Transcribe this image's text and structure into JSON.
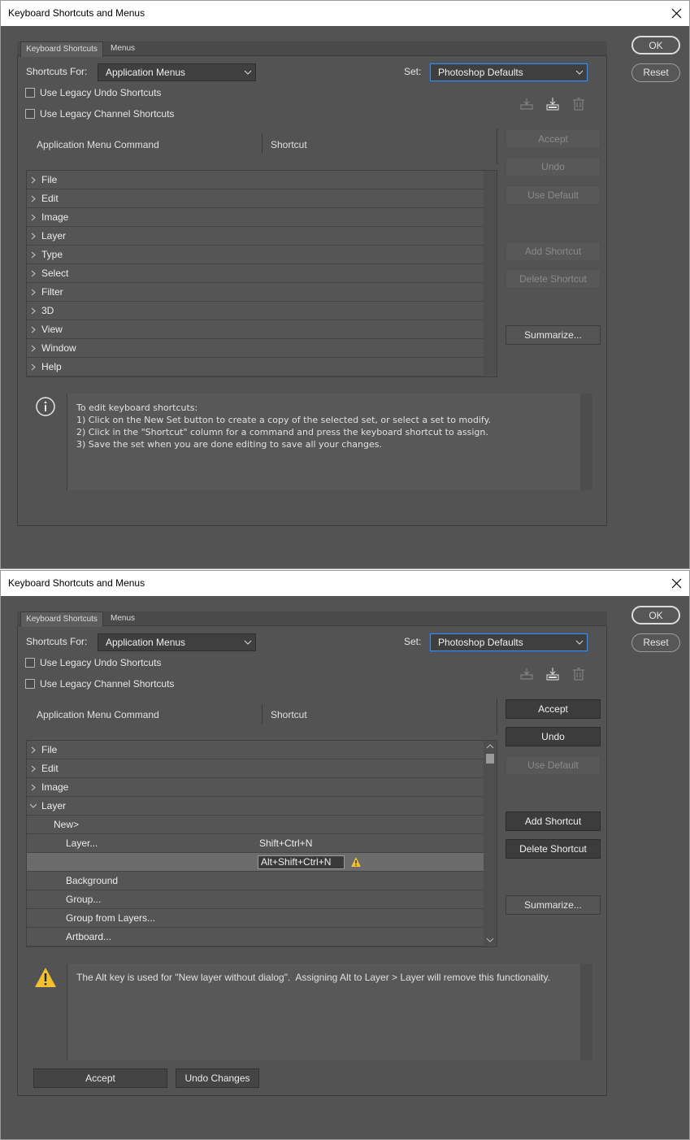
{
  "dialog1": {
    "title": "Keyboard Shortcuts and Menus",
    "tabs": [
      "Keyboard Shortcuts",
      "Menus"
    ],
    "shortcuts_for_label": "Shortcuts For:",
    "shortcuts_for_value": "Application Menus",
    "set_label": "Set:",
    "set_value": "Photoshop Defaults",
    "legacy_undo": "Use Legacy Undo Shortcuts",
    "legacy_channel": "Use Legacy Channel Shortcuts",
    "col_command": "Application Menu Command",
    "col_shortcut": "Shortcut",
    "menus": [
      "File",
      "Edit",
      "Image",
      "Layer",
      "Type",
      "Select",
      "Filter",
      "3D",
      "View",
      "Window",
      "Help"
    ],
    "buttons": {
      "ok": "OK",
      "reset": "Reset",
      "accept": "Accept",
      "undo": "Undo",
      "use_default": "Use Default",
      "add_shortcut": "Add Shortcut",
      "delete_shortcut": "Delete Shortcut",
      "summarize": "Summarize..."
    },
    "info_text": "To edit keyboard shortcuts:\n1) Click on the New Set button to create a copy of the selected set, or select a set to modify.\n2) Click in the \"Shortcut\" column for a command and press the keyboard shortcut to assign.\n3) Save the set when you are done editing to save all your changes."
  },
  "dialog2": {
    "title": "Keyboard Shortcuts and Menus",
    "tabs": [
      "Keyboard Shortcuts",
      "Menus"
    ],
    "shortcuts_for_label": "Shortcuts For:",
    "shortcuts_for_value": "Application Menus",
    "set_label": "Set:",
    "set_value": "Photoshop Defaults",
    "legacy_undo": "Use Legacy Undo Shortcuts",
    "legacy_channel": "Use Legacy Channel Shortcuts",
    "col_command": "Application Menu Command",
    "col_shortcut": "Shortcut",
    "rows": [
      {
        "label": "File",
        "shortcut": ""
      },
      {
        "label": "Edit",
        "shortcut": ""
      },
      {
        "label": "Image",
        "shortcut": ""
      },
      {
        "label": "Layer",
        "shortcut": ""
      },
      {
        "label": "New>",
        "shortcut": ""
      },
      {
        "label": "Layer...",
        "shortcut": "Shift+Ctrl+N"
      },
      {
        "label": "",
        "shortcut": "Alt+Shift+Ctrl+N"
      },
      {
        "label": "Background",
        "shortcut": ""
      },
      {
        "label": "Group...",
        "shortcut": ""
      },
      {
        "label": "Group from Layers...",
        "shortcut": ""
      },
      {
        "label": "Artboard...",
        "shortcut": ""
      }
    ],
    "buttons": {
      "ok": "OK",
      "reset": "Reset",
      "accept": "Accept",
      "undo": "Undo",
      "use_default": "Use Default",
      "add_shortcut": "Add Shortcut",
      "delete_shortcut": "Delete Shortcut",
      "summarize": "Summarize...",
      "bottom_accept": "Accept",
      "undo_changes": "Undo Changes"
    },
    "warning_text": "The Alt key is used for \"New layer without dialog\".  Assigning Alt to Layer > Layer will remove this functionality."
  }
}
